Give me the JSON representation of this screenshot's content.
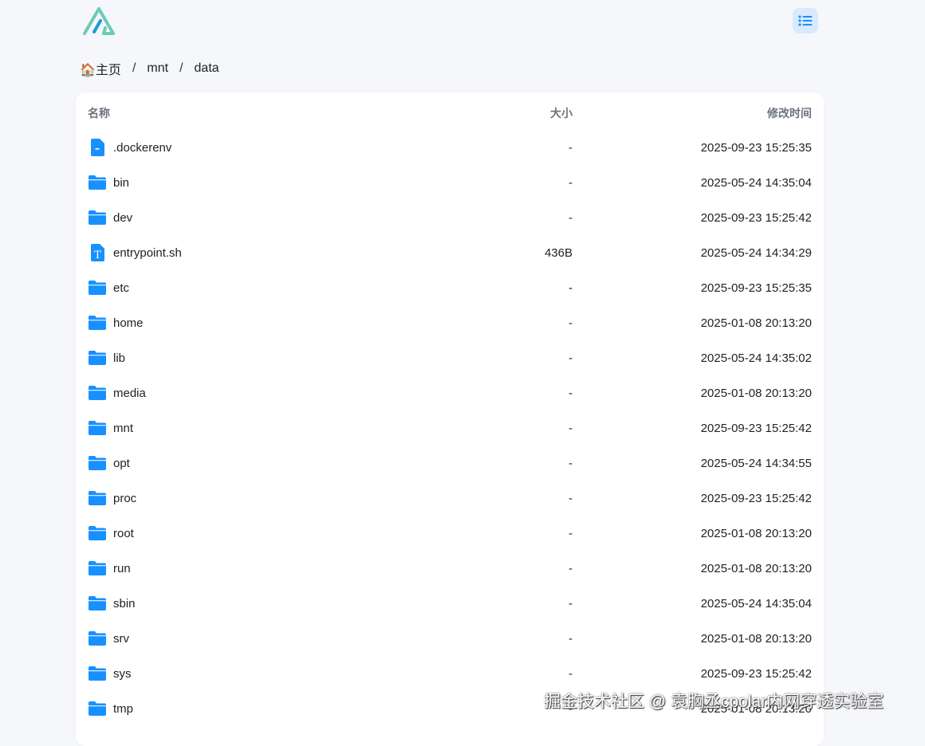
{
  "colors": {
    "accent": "#1890ff",
    "logo_teal": "#6ccab8",
    "logo_blue": "#1a9bd7"
  },
  "breadcrumb": {
    "home_icon": "house-emoji",
    "home_emoji": "🏠",
    "home": "主页",
    "items": [
      "mnt",
      "data"
    ],
    "separator": "/"
  },
  "header": {
    "menu_icon": "list-icon"
  },
  "table": {
    "headers": {
      "name": "名称",
      "size": "大小",
      "modified": "修改时间"
    },
    "rows": [
      {
        "name": ".dockerenv",
        "size": "-",
        "modified": "2025-09-23 15:25:35",
        "type": "file"
      },
      {
        "name": "bin",
        "size": "-",
        "modified": "2025-05-24 14:35:04",
        "type": "folder"
      },
      {
        "name": "dev",
        "size": "-",
        "modified": "2025-09-23 15:25:42",
        "type": "folder"
      },
      {
        "name": "entrypoint.sh",
        "size": "436B",
        "modified": "2025-05-24 14:34:29",
        "type": "text"
      },
      {
        "name": "etc",
        "size": "-",
        "modified": "2025-09-23 15:25:35",
        "type": "folder"
      },
      {
        "name": "home",
        "size": "-",
        "modified": "2025-01-08 20:13:20",
        "type": "folder"
      },
      {
        "name": "lib",
        "size": "-",
        "modified": "2025-05-24 14:35:02",
        "type": "folder"
      },
      {
        "name": "media",
        "size": "-",
        "modified": "2025-01-08 20:13:20",
        "type": "folder"
      },
      {
        "name": "mnt",
        "size": "-",
        "modified": "2025-09-23 15:25:42",
        "type": "folder"
      },
      {
        "name": "opt",
        "size": "-",
        "modified": "2025-05-24 14:34:55",
        "type": "folder"
      },
      {
        "name": "proc",
        "size": "-",
        "modified": "2025-09-23 15:25:42",
        "type": "folder"
      },
      {
        "name": "root",
        "size": "-",
        "modified": "2025-01-08 20:13:20",
        "type": "folder"
      },
      {
        "name": "run",
        "size": "-",
        "modified": "2025-01-08 20:13:20",
        "type": "folder"
      },
      {
        "name": "sbin",
        "size": "-",
        "modified": "2025-05-24 14:35:04",
        "type": "folder"
      },
      {
        "name": "srv",
        "size": "-",
        "modified": "2025-01-08 20:13:20",
        "type": "folder"
      },
      {
        "name": "sys",
        "size": "-",
        "modified": "2025-09-23 15:25:42",
        "type": "folder"
      },
      {
        "name": "tmp",
        "size": "-",
        "modified": "2025-01-08 20:13:20",
        "type": "folder"
      }
    ]
  },
  "watermark": "掘金技术社区 @ 袁胸丞cpolar内网穿透实验室"
}
